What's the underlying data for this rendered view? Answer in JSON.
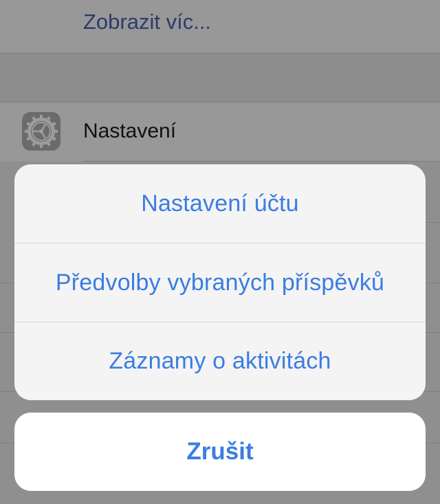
{
  "background_list": {
    "show_more_label": "Zobrazit víc...",
    "settings_label": "Nastavení",
    "settings_icon": "gear-icon"
  },
  "action_sheet": {
    "items": [
      {
        "label": "Nastavení účtu"
      },
      {
        "label": "Předvolby vybraných příspěvků"
      },
      {
        "label": "Záznamy o aktivitách"
      }
    ],
    "cancel_label": "Zrušit"
  },
  "colors": {
    "accent": "#3b7de0",
    "dim_background": "#989898",
    "sheet_background": "#f4f4f4"
  }
}
